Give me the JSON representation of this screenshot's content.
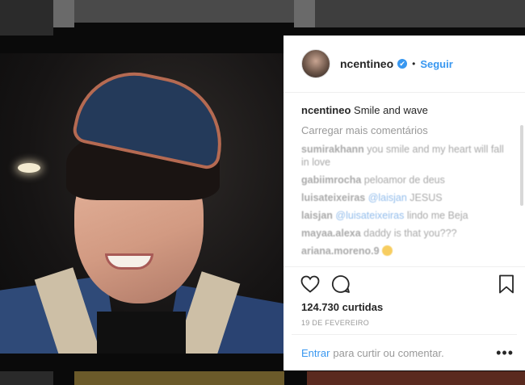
{
  "post": {
    "username": "ncentineo",
    "follow_label": "Seguir",
    "separator": "•",
    "verified_glyph": "✔",
    "caption_user": "ncentineo",
    "caption_text": "Smile and wave",
    "load_more": "Carregar mais comentários",
    "comments": [
      {
        "user": "sumirakhann",
        "text": " you smile and my heart will fall in love"
      },
      {
        "user": "gabiimrocha",
        "text": " peloamor de deus"
      },
      {
        "user": "luisateixeiras",
        "mention": " @laisjan",
        "text": " JESUS"
      },
      {
        "user": "laisjan",
        "mention": " @luisateixeiras",
        "text": " lindo me Beja"
      },
      {
        "user": "mayaa.alexa",
        "text": " daddy is that you???"
      },
      {
        "user": "ariana.moreno.9",
        "text": " "
      }
    ],
    "likes": "124.730 curtidas",
    "date": "19 DE FEVEREIRO",
    "login_link": "Entrar",
    "login_rest": "para curtir ou comentar.",
    "more_glyph": "•••"
  },
  "icons": [
    "heart-icon",
    "comment-icon",
    "bookmark-icon",
    "verified-icon",
    "more-options-icon"
  ],
  "colors": {
    "accent": "#3897f0",
    "text": "#262626",
    "muted": "#999999"
  }
}
